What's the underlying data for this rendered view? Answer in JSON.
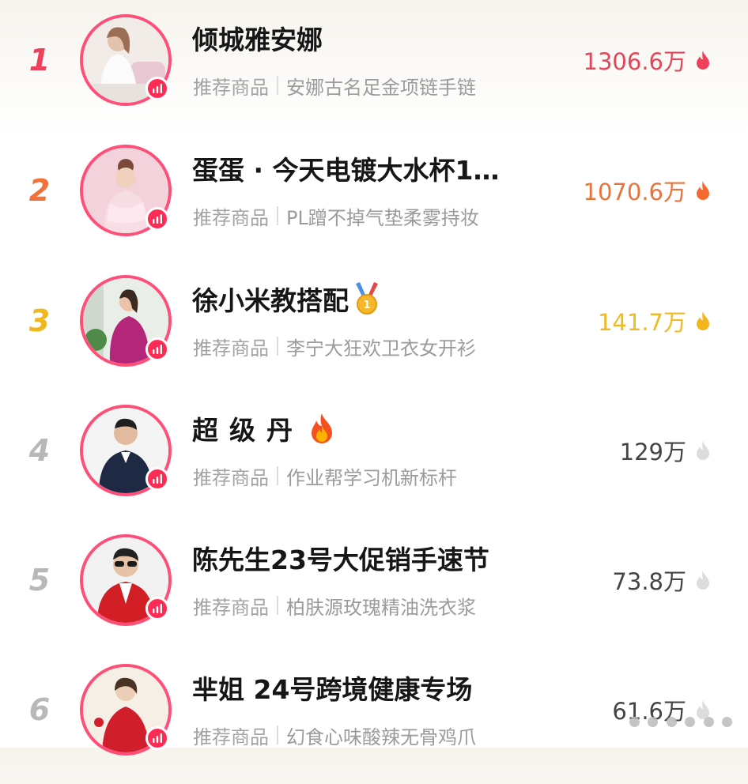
{
  "colors": {
    "accent": "#fe2c55",
    "avatar_ring": "#ff4f78",
    "rank_1": "#f0405c",
    "rank_2": "#f2703a",
    "rank_3": "#f0b820",
    "rank_other": "#b8b8b8",
    "heat_1": "#e2465a",
    "heat_2": "#e8743a",
    "heat_3": "#eebb22",
    "heat_other": "#444444",
    "muted_text": "#9a9a9a"
  },
  "streamers": [
    {
      "rank": "1",
      "name": "倾城雅安娜",
      "badge": "",
      "label": "推荐商品",
      "product": "安娜古名足金项链手链",
      "heat": "1306.6万",
      "heat_icon": "flame-red-icon"
    },
    {
      "rank": "2",
      "name": "蛋蛋 · 今天电镀大水杯1…",
      "badge": "",
      "label": "推荐商品",
      "product": "PL蹭不掉气垫柔雾持妆",
      "heat": "1070.6万",
      "heat_icon": "flame-orange-icon"
    },
    {
      "rank": "3",
      "name": "徐小米教搭配",
      "badge": "gold-medal-icon",
      "label": "推荐商品",
      "product": "李宁大狂欢卫衣女开衫",
      "heat": "141.7万",
      "heat_icon": "flame-yellow-icon"
    },
    {
      "rank": "4",
      "name": "超级丹",
      "badge": "fire-emoji-icon",
      "label": "推荐商品",
      "product": "作业帮学习机新标杆",
      "heat": "129万",
      "heat_icon": "flame-gray-icon"
    },
    {
      "rank": "5",
      "name": "陈先生23号大促销手速节",
      "badge": "",
      "label": "推荐商品",
      "product": "柏肤源玫瑰精油洗衣浆",
      "heat": "73.8万",
      "heat_icon": "flame-gray-icon"
    },
    {
      "rank": "6",
      "name": "芈姐 24号跨境健康专场",
      "badge": "",
      "label": "推荐商品",
      "product": "幻食心味酸辣无骨鸡爪",
      "heat": "61.6万",
      "heat_icon": "flame-gray-icon"
    }
  ],
  "overlay": {
    "more_icon": "more-dots-icon"
  }
}
